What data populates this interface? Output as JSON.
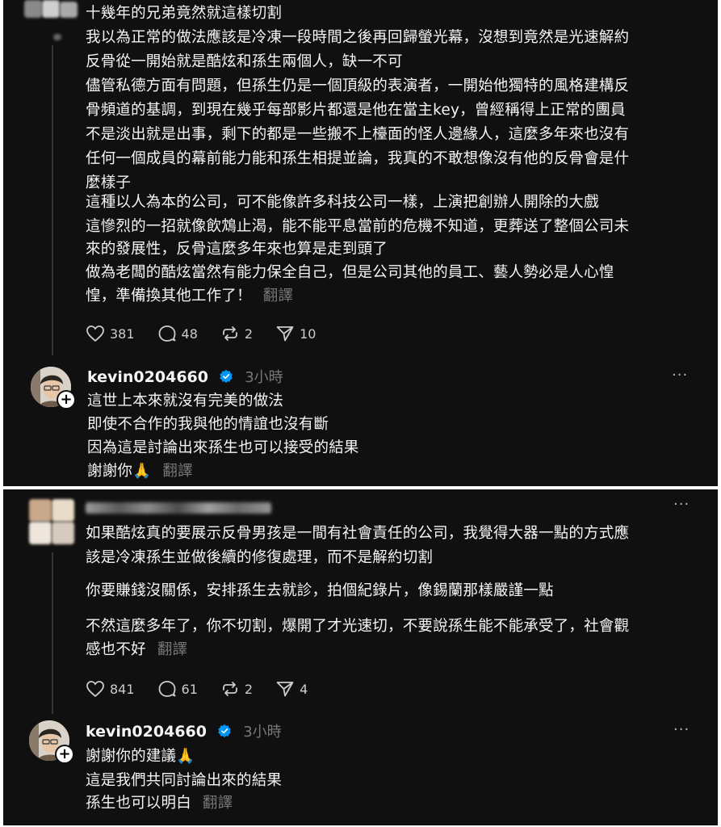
{
  "colors": {
    "background": "#101010",
    "text": "#f3f5f7",
    "muted": "#777777",
    "verified": "#0095f6"
  },
  "icons": {
    "like": "heart-icon",
    "comment": "comment-icon",
    "repost": "repost-icon",
    "share": "send-icon",
    "verified": "verified-badge-icon",
    "more": "more-icon",
    "follow": "plus-icon"
  },
  "translate_label": "翻譯",
  "more_label": "···",
  "comment1": {
    "lines": [
      "十幾年的兄弟竟然就這樣切割",
      "我以為正常的做法應該是冷凍一段時間之後再回歸螢光幕，沒想到竟然是光速解約",
      "反骨從一開始就是酷炫和孫生兩個人，缺一不可",
      "儘管私德方面有問題，但孫生仍是一個頂級的表演者，一開始他獨特的風格建構反",
      "骨頻道的基調，到現在幾乎每部影片都還是他在當主key，曾經稱得上正常的團員",
      "不是淡出就是出事，剩下的都是一些搬不上檯面的怪人邊緣人，這麼多年來也沒有",
      "任何一個成員的幕前能力能和孫生相提並論，我真的不敢想像沒有他的反骨會是什",
      "麼樣子",
      "這種以人為本的公司，可不能像許多科技公司一樣，上演把創辦人開除的大戲",
      "這慘烈的一招就像飲鴆止渴，能不能平息當前的危機不知道，更葬送了整個公司未",
      "來的發展性，反骨這麼多年來也算是走到頭了",
      "做為老闆的酷炫當然有能力保全自己，但是公司其他的員工、藝人勢必是人心惶",
      "惶，準備換其他工作了！"
    ],
    "likes": "381",
    "comments": "48",
    "reposts": "2",
    "shares": "10"
  },
  "reply1": {
    "username": "kevin0204660",
    "time": "3小時",
    "lines": [
      "這世上本來就沒有完美的做法",
      "即使不合作的我與他的情誼也沒有斷",
      "因為這是討論出來孫生也可以接受的結果",
      "謝謝你🙏"
    ]
  },
  "comment2": {
    "lines": [
      "如果酷炫真的要展示反骨男孩是一間有社會責任的公司，我覺得大器一點的方式應",
      "該是冷凍孫生並做後續的修復處理，而不是解約切割",
      "你要賺錢沒關係，安排孫生去就診，拍個紀錄片，像錫蘭那樣嚴謹一點",
      "不然這麼多年了，你不切割，爆開了才光速切，不要說孫生能不能承受了，社會觀",
      "感也不好"
    ],
    "likes": "841",
    "comments": "61",
    "reposts": "2",
    "shares": "4"
  },
  "reply2": {
    "username": "kevin0204660",
    "time": "3小時",
    "lines": [
      "謝謝你的建議🙏",
      "這是我們共同討論出來的結果",
      "孫生也可以明白"
    ]
  }
}
